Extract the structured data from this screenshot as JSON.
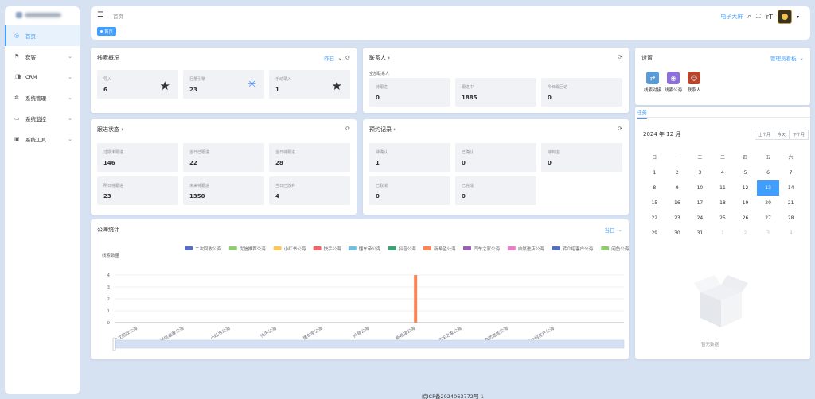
{
  "sidebar": {
    "items": [
      {
        "label": "首页",
        "icon": "dashboard-icon"
      },
      {
        "label": "获客",
        "icon": "flag-icon"
      },
      {
        "label": "CRM",
        "icon": "users-icon"
      },
      {
        "label": "系统管理",
        "icon": "gear-icon"
      },
      {
        "label": "系统监控",
        "icon": "monitor-icon"
      },
      {
        "label": "系统工具",
        "icon": "toolbox-icon"
      }
    ]
  },
  "header": {
    "breadcrumb": "首页",
    "tag": "首页",
    "big_screen": "电子大屏"
  },
  "leads": {
    "title": "线索概况",
    "filter": "昨日",
    "stats": [
      {
        "label": "导入",
        "value": "6"
      },
      {
        "label": "巨量引擎",
        "value": "23"
      },
      {
        "label": "手动录入",
        "value": "1"
      }
    ]
  },
  "contacts": {
    "title": "联系人",
    "subtitle": "全部联系人",
    "stats": [
      {
        "label": "待跟进",
        "value": "0"
      },
      {
        "label": "跟进中",
        "value": "1885"
      },
      {
        "label": "今日需回访",
        "value": "0"
      }
    ]
  },
  "settings": {
    "title": "设置",
    "dropdown": "管理员看板",
    "shortcuts": [
      {
        "label": "线索对接",
        "color": "#5b9bd5"
      },
      {
        "label": "线索公海",
        "color": "#8e6fd8"
      },
      {
        "label": "联系人",
        "color": "#b8462f"
      }
    ]
  },
  "followup": {
    "title": "跟进状态",
    "stats": [
      {
        "label": "过期未跟进",
        "value": "146"
      },
      {
        "label": "当日已跟进",
        "value": "22"
      },
      {
        "label": "当日待跟进",
        "value": "28"
      },
      {
        "label": "明日待跟进",
        "value": "23"
      },
      {
        "label": "未来待跟进",
        "value": "1350"
      },
      {
        "label": "当日已放弃",
        "value": "4"
      }
    ]
  },
  "appointments": {
    "title": "预约记录",
    "stats": [
      {
        "label": "待确认",
        "value": "1"
      },
      {
        "label": "已确认",
        "value": "0"
      },
      {
        "label": "待到店",
        "value": "0"
      },
      {
        "label": "已取消",
        "value": "0"
      },
      {
        "label": "已完成",
        "value": "0"
      }
    ]
  },
  "pool": {
    "title": "公海统计",
    "filter": "当日"
  },
  "tasks": {
    "tab": "任务",
    "calendar_title": "2024 年 12 月",
    "btn_prev": "上个月",
    "btn_today": "今天",
    "btn_next": "下个月",
    "weekdays": [
      "日",
      "一",
      "二",
      "三",
      "四",
      "五",
      "六"
    ],
    "empty": "暂无数据"
  },
  "footer": "皖ICP备2024063772号-1",
  "chart_data": {
    "type": "bar",
    "ylabel": "线索数量",
    "ylim": [
      0,
      4
    ],
    "yticks": [
      0,
      1,
      2,
      3,
      4
    ],
    "categories": [
      "二次回收公海",
      "优信推荐公海",
      "小红书公海",
      "快手公海",
      "懂车帝公海",
      "抖音公海",
      "新希望公海",
      "汽车之家公海",
      "自然进店公海",
      "转介绍客户公海",
      "闲鱼公海"
    ],
    "legend_colors": [
      "#5470c6",
      "#91cc75",
      "#fac858",
      "#ee6666",
      "#73c0de",
      "#3ba272",
      "#fc8452",
      "#9a60b4",
      "#ea7ccc",
      "#5470c6",
      "#91cc75"
    ],
    "series": [
      {
        "values": [
          0,
          0,
          0,
          0,
          0,
          0,
          4,
          0,
          0,
          0,
          0
        ]
      }
    ],
    "x_tick_labels": [
      "二次回收公海",
      "优信推荐公海",
      "小红书公海",
      "快手公海",
      "懂车帝公海",
      "抖音公海",
      "新希望公海",
      "汽车之家公海",
      "自然进店公海",
      "转介绍客户公海"
    ]
  }
}
